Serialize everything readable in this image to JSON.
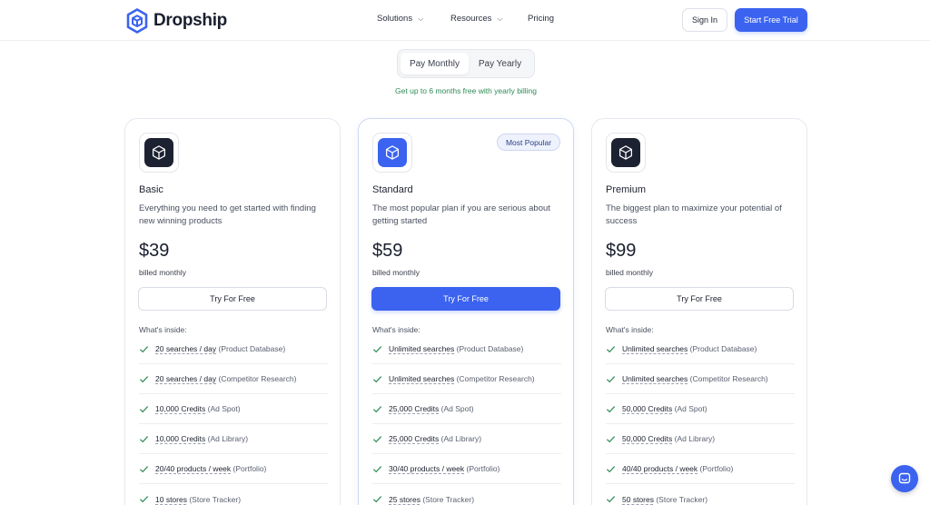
{
  "colors": {
    "accent": "#3b63f0",
    "promo": "#2e8b57",
    "dark_icon": "#1d2233"
  },
  "brand": {
    "name": "Dropship",
    "icon": "cube-hexagon-icon"
  },
  "nav": {
    "solutions": "Solutions",
    "resources": "Resources",
    "pricing": "Pricing",
    "sign_in": "Sign In",
    "trial": "Start Free Trial"
  },
  "billing_toggle": {
    "monthly": "Pay Monthly",
    "yearly": "Pay Yearly",
    "selected": "Pay Monthly",
    "promo": "Get up to 6 months free with yearly billing"
  },
  "plans": [
    {
      "name": "Basic",
      "icon": "cube-icon",
      "description": "Everything you need to get started with finding new winning products",
      "price": "$39",
      "billed": "billed monthly",
      "cta": "Try For Free",
      "inside_label": "What's inside:",
      "features": [
        {
          "highlight": "20 searches / day",
          "note": "(Product Database)"
        },
        {
          "highlight": "20 searches / day",
          "note": "(Competitor Research)"
        },
        {
          "highlight": "10,000 Credits",
          "note": "(Ad Spot)"
        },
        {
          "highlight": "10,000 Credits",
          "note": "(Ad Library)"
        },
        {
          "highlight": "20/40 products / week",
          "note": "(Portfolio)"
        },
        {
          "highlight": "10 stores",
          "note": "(Store Tracker)"
        }
      ]
    },
    {
      "name": "Standard",
      "badge": "Most Popular",
      "icon": "cube-icon",
      "description": "The most popular plan if you are serious about getting started",
      "price": "$59",
      "billed": "billed monthly",
      "cta": "Try For Free",
      "inside_label": "What's inside:",
      "features": [
        {
          "highlight": "Unlimited searches",
          "note": "(Product Database)"
        },
        {
          "highlight": "Unlimited searches",
          "note": "(Competitor Research)"
        },
        {
          "highlight": "25,000 Credits",
          "note": "(Ad Spot)"
        },
        {
          "highlight": "25,000 Credits",
          "note": "(Ad Library)"
        },
        {
          "highlight": "30/40 products / week",
          "note": "(Portfolio)"
        },
        {
          "highlight": "25 stores",
          "note": "(Store Tracker)"
        }
      ]
    },
    {
      "name": "Premium",
      "icon": "cube-icon",
      "description": "The biggest plan to maximize your potential of success",
      "price": "$99",
      "billed": "billed monthly",
      "cta": "Try For Free",
      "inside_label": "What's inside:",
      "features": [
        {
          "highlight": "Unlimited searches",
          "note": "(Product Database)"
        },
        {
          "highlight": "Unlimited searches",
          "note": "(Competitor Research)"
        },
        {
          "highlight": "50,000 Credits",
          "note": "(Ad Spot)"
        },
        {
          "highlight": "50,000 Credits",
          "note": "(Ad Library)"
        },
        {
          "highlight": "40/40 products / week",
          "note": "(Portfolio)"
        },
        {
          "highlight": "50 stores",
          "note": "(Store Tracker)"
        }
      ]
    }
  ],
  "chat": {
    "icon": "chat-icon"
  }
}
